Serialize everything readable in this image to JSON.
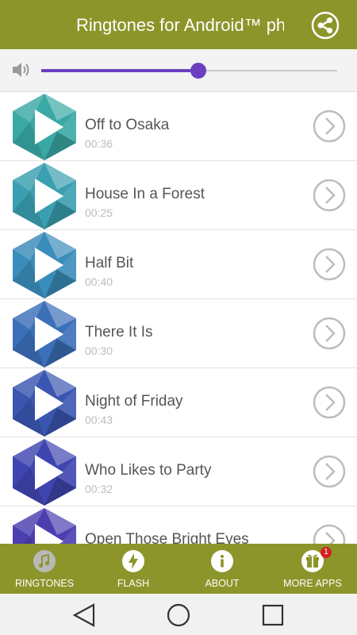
{
  "app_bar": {
    "title": "Ringtones for Android™ phones",
    "share_icon": "share-icon"
  },
  "volume": {
    "icon": "speaker-icon",
    "level_fraction": 0.53,
    "accent": "#6a3fc0"
  },
  "ringtones": [
    {
      "title": "Off to Osaka",
      "duration": "00:36",
      "color": "#3aa9a5"
    },
    {
      "title": "House In a Forest",
      "duration": "00:25",
      "color": "#3a9fb0"
    },
    {
      "title": "Half Bit",
      "duration": "00:40",
      "color": "#3a8cba"
    },
    {
      "title": "There It Is",
      "duration": "00:30",
      "color": "#3b6fb8"
    },
    {
      "title": "Night of Friday",
      "duration": "00:43",
      "color": "#3a56b0"
    },
    {
      "title": "Who Likes to Party",
      "duration": "00:32",
      "color": "#3f45b0"
    },
    {
      "title": "Open Those Bright Eyes",
      "duration": "",
      "color": "#4a3eb0"
    }
  ],
  "bottom_nav": {
    "background": "#8c952a",
    "items": [
      {
        "label": "RINGTONES",
        "icon": "music-note-icon"
      },
      {
        "label": "FLASH",
        "icon": "flash-icon"
      },
      {
        "label": "ABOUT",
        "icon": "info-icon"
      },
      {
        "label": "MORE APPS",
        "icon": "gift-icon",
        "badge": "1"
      }
    ]
  },
  "system_nav": {
    "icons": [
      "back-icon",
      "home-icon",
      "recents-icon"
    ]
  }
}
